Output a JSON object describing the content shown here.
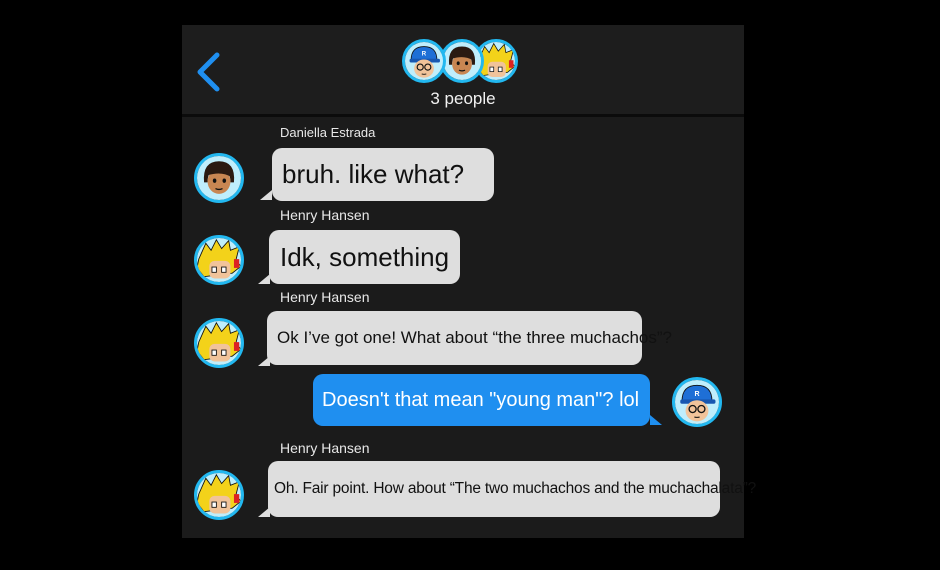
{
  "header": {
    "back_icon": "chevron-left-icon",
    "people_count": "3 people"
  },
  "messages": [
    {
      "sender": "Daniella Estrada",
      "text": "bruh. like what?",
      "direction": "incoming",
      "avatar": "daniella"
    },
    {
      "sender": "Henry Hansen",
      "text": "Idk, something",
      "direction": "incoming",
      "avatar": "henry"
    },
    {
      "sender": "Henry Hansen",
      "text": "Ok I’ve got one! What about “the three muchachos”?",
      "direction": "incoming",
      "avatar": "henry"
    },
    {
      "sender": "",
      "text": "Doesn't that mean \"young man\"? lol",
      "direction": "outgoing",
      "avatar": "me"
    },
    {
      "sender": "Henry Hansen",
      "text": "Oh. Fair point. How about “The two muchachos and the muchachalata”?",
      "direction": "incoming",
      "avatar": "henry"
    }
  ],
  "colors": {
    "accent": "#22b8f0",
    "outgoing_bubble": "#1f8ff0",
    "incoming_bubble": "#dedede",
    "background": "#1b1b1b"
  }
}
